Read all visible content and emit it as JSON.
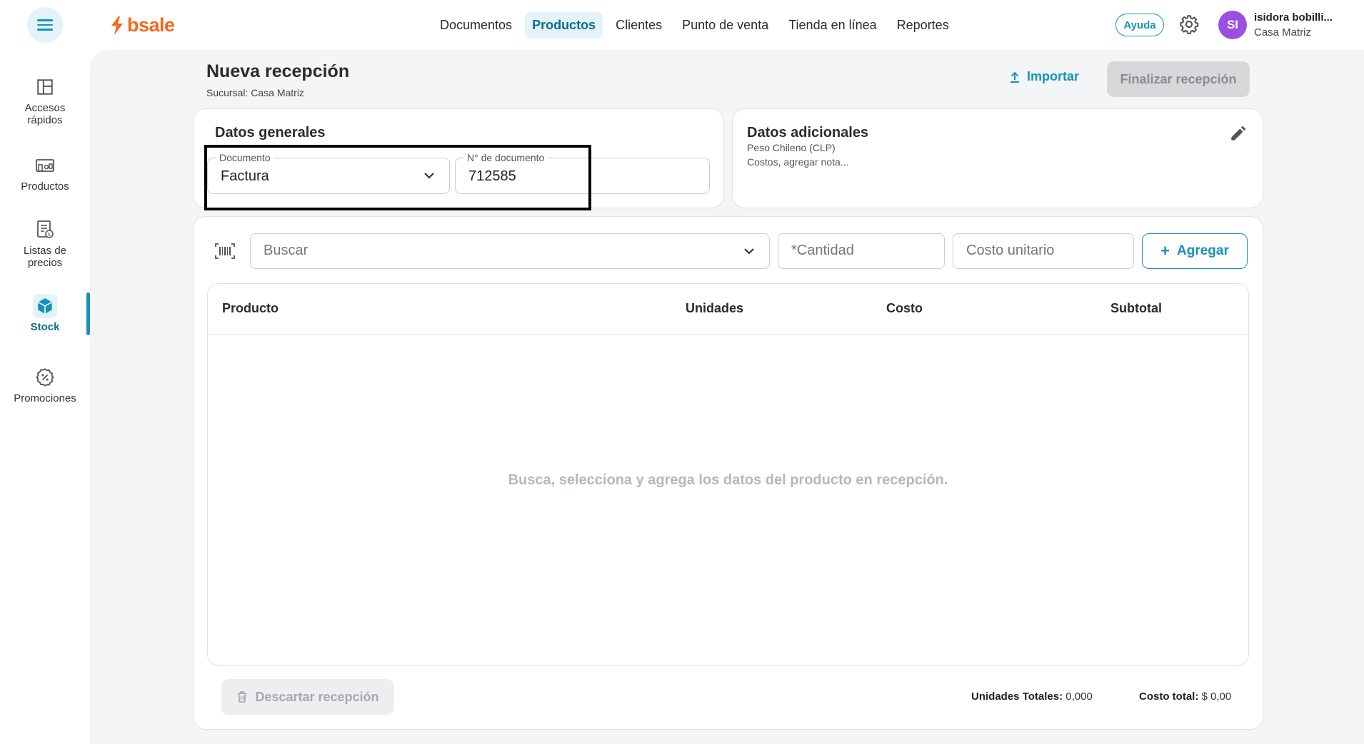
{
  "header": {
    "logo_text": "bsale",
    "nav": [
      {
        "label": "Documentos"
      },
      {
        "label": "Productos"
      },
      {
        "label": "Clientes"
      },
      {
        "label": "Punto de venta"
      },
      {
        "label": "Tienda en línea"
      },
      {
        "label": "Reportes"
      }
    ],
    "help_label": "Ayuda",
    "avatar_initials": "SI",
    "user_name": "isidora bobilli...",
    "user_branch": "Casa Matriz"
  },
  "sidebar": {
    "items": [
      {
        "label_line1": "Accesos",
        "label_line2": "rápidos",
        "icon": "layout-icon"
      },
      {
        "label_line1": "Productos",
        "label_line2": "",
        "icon": "products-icon"
      },
      {
        "label_line1": "Listas de",
        "label_line2": "precios",
        "icon": "price-list-icon"
      },
      {
        "label_line1": "Stock",
        "label_line2": "",
        "icon": "box-icon"
      },
      {
        "label_line1": "Promociones",
        "label_line2": "",
        "icon": "discount-icon"
      }
    ]
  },
  "page": {
    "title": "Nueva recepción",
    "subtitle": "Sucursal: Casa Matriz",
    "import_label": "Importar",
    "finish_label": "Finalizar recepción"
  },
  "general": {
    "title": "Datos generales",
    "document_label": "Documento",
    "document_value": "Factura",
    "number_label": "N° de documento",
    "number_value": "712585"
  },
  "additional": {
    "title": "Datos adicionales",
    "currency": "Peso Chileno (CLP)",
    "notes": "Costos, agregar nota..."
  },
  "search": {
    "search_placeholder": "Buscar",
    "quantity_placeholder": "*Cantidad",
    "cost_placeholder": "Costo unitario",
    "add_label": "Agregar"
  },
  "table": {
    "columns": [
      "Producto",
      "Unidades",
      "Costo",
      "Subtotal"
    ],
    "empty_message": "Busca, selecciona y agrega los datos del producto en recepción."
  },
  "footer": {
    "discard_label": "Descartar recepción",
    "units_label": "Unidades Totales:",
    "units_value": "0,000",
    "cost_label": "Costo total:",
    "cost_value": "$ 0,00"
  },
  "colors": {
    "accent": "#1693b9",
    "brand": "#f26a1b",
    "avatar": "#9a4fe0"
  }
}
